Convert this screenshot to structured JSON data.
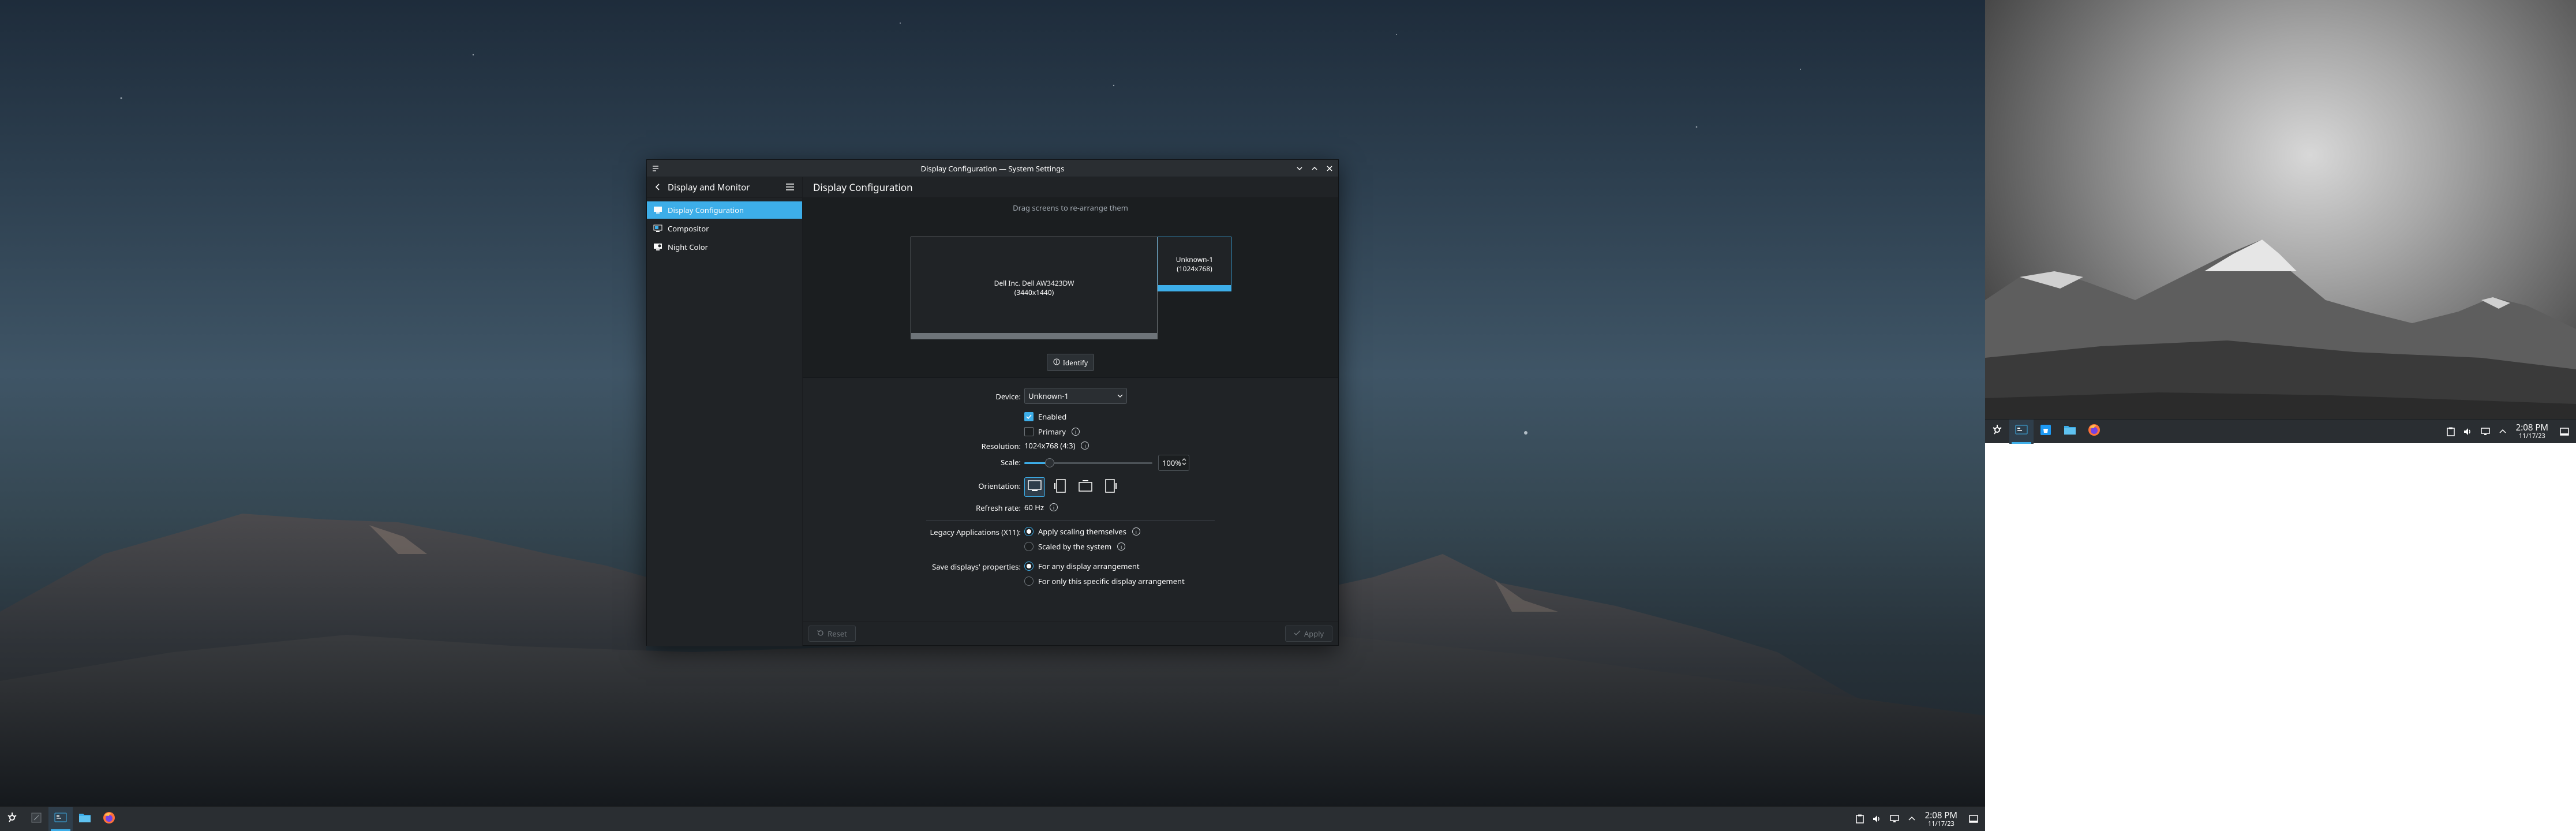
{
  "window": {
    "title": "Display Configuration — System Settings"
  },
  "sidebar": {
    "header_title": "Display and Monitor",
    "items": [
      {
        "label": "Display Configuration",
        "icon": "display-icon"
      },
      {
        "label": "Compositor",
        "icon": "compositor-icon"
      },
      {
        "label": "Night Color",
        "icon": "night-color-icon"
      }
    ]
  },
  "main": {
    "title": "Display Configuration",
    "arrange_hint": "Drag screens to re-arrange them",
    "screens": [
      {
        "name": "Dell Inc. Dell AW3423DW",
        "resolution": "(3440x1440)"
      },
      {
        "name": "Unknown-1",
        "resolution": "(1024x768)"
      }
    ],
    "identify_label": "Identify"
  },
  "settings": {
    "device_label": "Device:",
    "device_value": "Unknown-1",
    "enabled_label": "Enabled",
    "primary_label": "Primary",
    "resolution_label": "Resolution:",
    "resolution_value": "1024x768 (4:3)",
    "scale_label": "Scale:",
    "scale_value": "100%",
    "scale_fraction": 0.2,
    "orientation_label": "Orientation:",
    "refresh_label": "Refresh rate:",
    "refresh_value": "60 Hz",
    "legacy_label": "Legacy Applications (X11):",
    "legacy_opt1": "Apply scaling themselves",
    "legacy_opt2": "Scaled by the system",
    "save_label": "Save displays' properties:",
    "save_opt1": "For any display arrangement",
    "save_opt2": "For only this specific display arrangement"
  },
  "footer": {
    "reset_label": "Reset",
    "apply_label": "Apply"
  },
  "panel_left": {
    "time": "2:08 PM",
    "date": "11/17/23"
  },
  "panel_right": {
    "time": "2:08 PM",
    "date": "11/17/23"
  },
  "colors": {
    "accent": "#3daee9",
    "window_bg": "#202326",
    "panel_bg": "#2a2e32"
  }
}
